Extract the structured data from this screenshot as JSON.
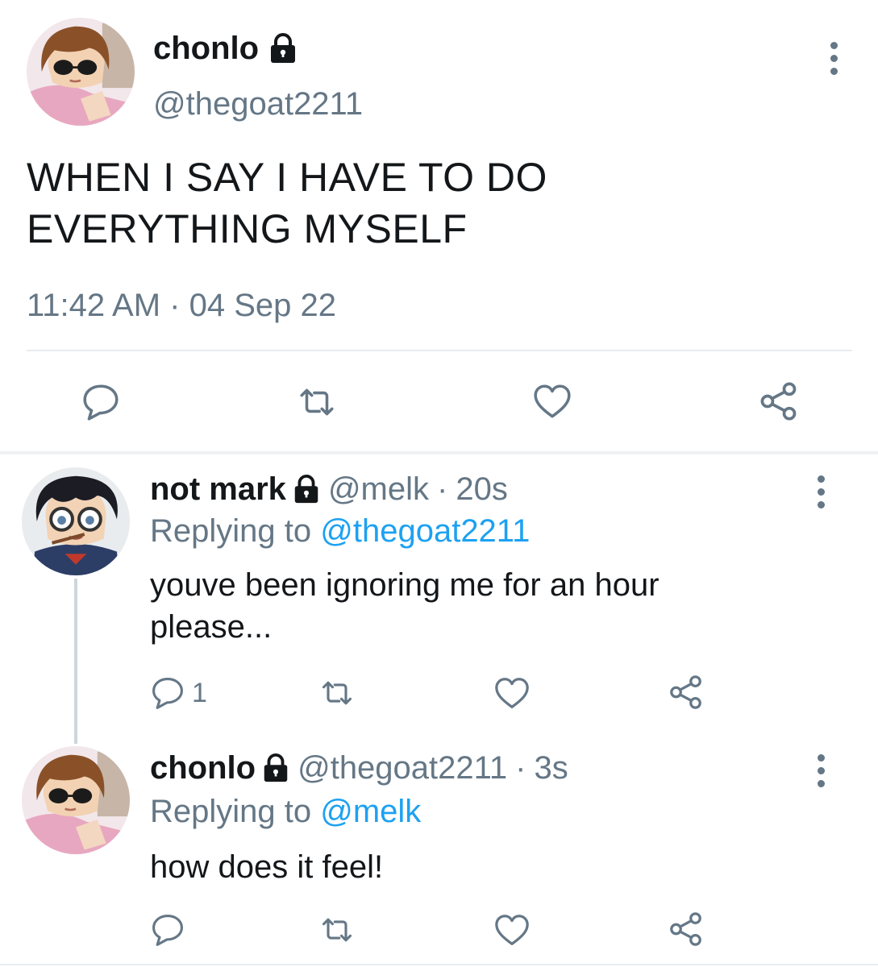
{
  "main_tweet": {
    "author": {
      "name": "chonlo",
      "handle": "@thegoat2211",
      "avatar_icon": "anime-avatar-chonlo",
      "protected_icon": "lock-icon"
    },
    "text": "WHEN I SAY I HAVE TO DO EVERYTHING MYSELF",
    "text_lines": [
      "WHEN I SAY I HAVE TO DO",
      "EVERYTHING MYSELF"
    ],
    "time": "11:42 AM",
    "separator": "·",
    "date": "04 Sep 22",
    "actions": [
      "reply-icon",
      "retweet-icon",
      "like-icon",
      "share-icon"
    ]
  },
  "replies": [
    {
      "author": {
        "name": "not mark",
        "handle": "@melk",
        "avatar_icon": "anime-avatar-not-mark",
        "protected_icon": "lock-icon"
      },
      "separator": "·",
      "time": "20s",
      "replying_label": "Replying to",
      "replying_to": "@thegoat2211",
      "text_lines": [
        "youve been ignoring me for an hour",
        "please..."
      ],
      "reply_count": "1",
      "actions": [
        "reply-icon",
        "retweet-icon",
        "like-icon",
        "share-icon"
      ]
    },
    {
      "author": {
        "name": "chonlo",
        "handle": "@thegoat2211",
        "avatar_icon": "anime-avatar-chonlo",
        "protected_icon": "lock-icon"
      },
      "separator": "·",
      "time": "3s",
      "replying_label": "Replying to",
      "replying_to": "@melk",
      "text_lines": [
        "how does it feel!"
      ],
      "actions": [
        "reply-icon",
        "retweet-icon",
        "like-icon",
        "share-icon"
      ]
    }
  ],
  "colors": {
    "text": "#14171a",
    "secondary": "#657786",
    "link": "#1da1f2",
    "divider": "#e6ecf0"
  }
}
